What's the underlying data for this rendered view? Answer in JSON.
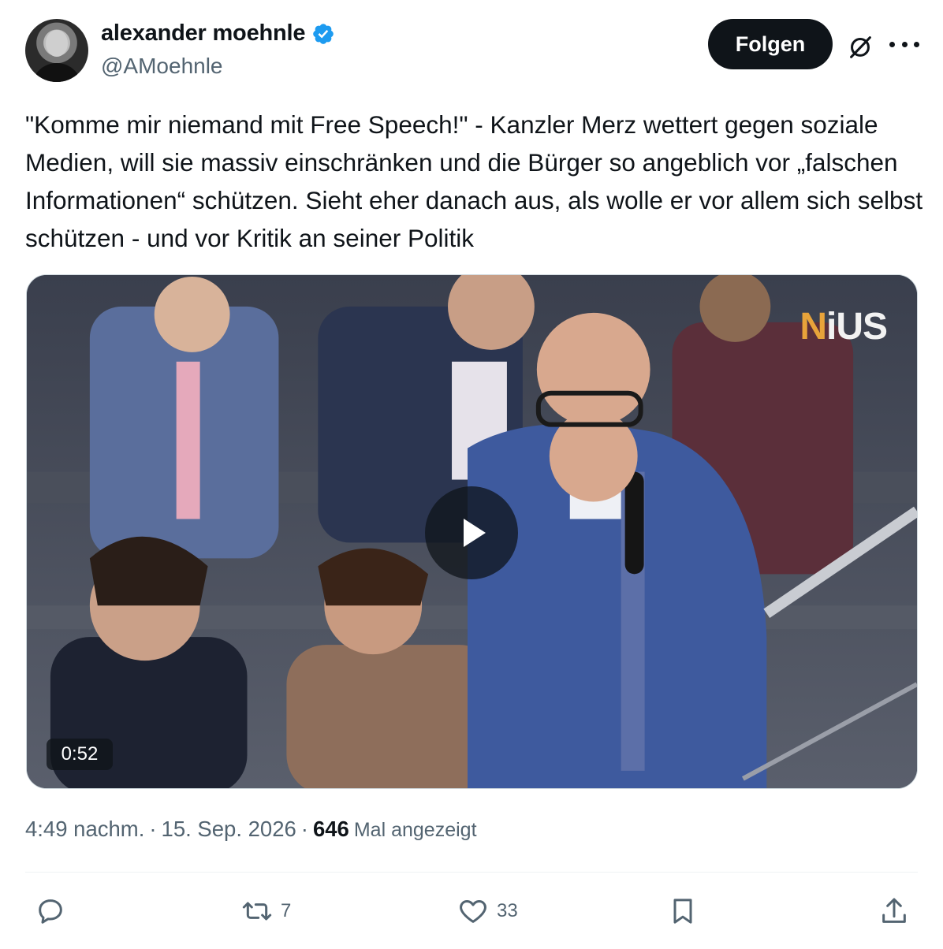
{
  "author": {
    "display_name": "alexander moehnle",
    "handle": "@AMoehnle",
    "verified": true,
    "verified_color": "#1d9bf0"
  },
  "header": {
    "follow_label": "Folgen",
    "grok_icon": "grok-slash-icon",
    "more_icon": "more-dots-icon"
  },
  "tweet": {
    "text": "\"Komme mir niemand mit Free Speech!\" - Kanzler Merz wettert gegen soziale Medien, will sie massiv einschränken und die Bürger so angeblich vor „falschen Informationen“ schützen. Sieht eher danach aus, als wolle er vor allem sich selbst schützen - und vor Kritik an seiner Politik"
  },
  "media": {
    "type": "video",
    "duration": "0:52",
    "watermark_prefix": "N",
    "watermark_rest": "iUS"
  },
  "meta": {
    "time": "4:49 nachm.",
    "separator": "·",
    "date": "15. Sep. 2026",
    "views_count": "646",
    "views_label": "Mal angezeigt"
  },
  "actions": {
    "reply_count": "",
    "retweet_count": "7",
    "like_count": "33"
  },
  "colors": {
    "text_primary": "#0f1419",
    "text_secondary": "#536471",
    "follow_bg": "#0f1419",
    "divider": "#eff3f4"
  }
}
